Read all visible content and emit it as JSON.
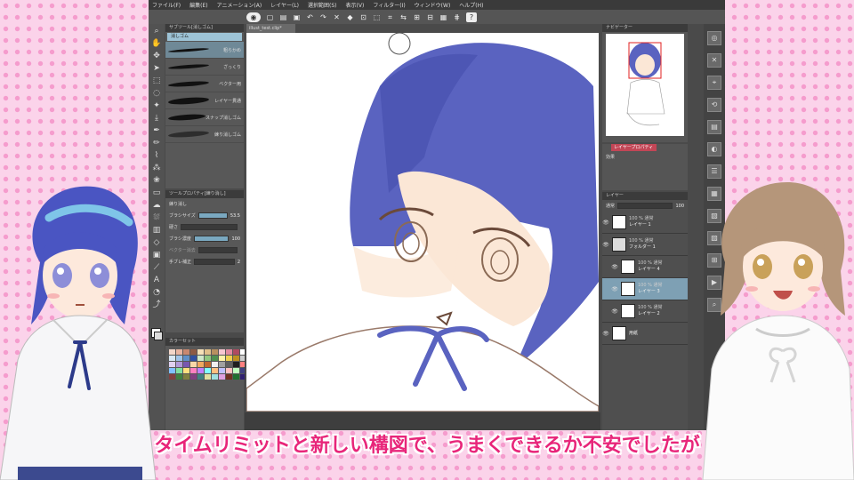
{
  "menu": [
    "ファイル(F)",
    "編集(E)",
    "アニメーション(A)",
    "レイヤー(L)",
    "選択範囲(S)",
    "表示(V)",
    "フィルター(I)",
    "ウィンドウ(W)",
    "ヘルプ(H)"
  ],
  "toolbar": {
    "help": "?"
  },
  "subtool": {
    "title": "サブツール[消しゴム]",
    "tab": "消しゴム",
    "brushes": [
      "粗らかめ",
      "ざっくり",
      "ベクター用",
      "レイヤー貫通",
      "スナップ消しゴム",
      "練り消しゴム"
    ]
  },
  "toolprop": {
    "title": "ツールプロパティ[練り消し]",
    "name": "練り消し",
    "rows": [
      {
        "label": "ブラシサイズ",
        "value": "53.5"
      },
      {
        "label": "硬さ",
        "value": ""
      },
      {
        "label": "ブラシ濃度",
        "value": "100"
      },
      {
        "label": "ベクター消去",
        "value": ""
      },
      {
        "label": "手ブレ補正",
        "value": "2"
      }
    ]
  },
  "colorset": {
    "title": "カラーセット"
  },
  "document": {
    "tab": "illust_test.clip*"
  },
  "navigator": {
    "title": "ナビゲーター"
  },
  "layerprop": {
    "title": "レイヤープロパティ",
    "effect": "効果"
  },
  "layer_panel": {
    "title": "レイヤー",
    "blend": "通常",
    "opacity": "100",
    "layers": [
      {
        "mode": "100 % 通常",
        "name": "レイヤー 1"
      },
      {
        "mode": "100 % 通常",
        "name": "フォルダー 1"
      },
      {
        "mode": "100 % 通常",
        "name": "レイヤー 4"
      },
      {
        "mode": "100 % 通常",
        "name": "レイヤー 3"
      },
      {
        "mode": "100 % 通常",
        "name": "レイヤー 2"
      },
      {
        "mode": "",
        "name": "用紙"
      }
    ]
  },
  "subtitle": "タイムリミットと新しい構図で、うまくできるか不安でしたが",
  "colors": {
    "hair": "#5a63c0",
    "skin": "#fbe7d6",
    "accent": "#e8267a",
    "selected_row": "#7ea0b4"
  }
}
